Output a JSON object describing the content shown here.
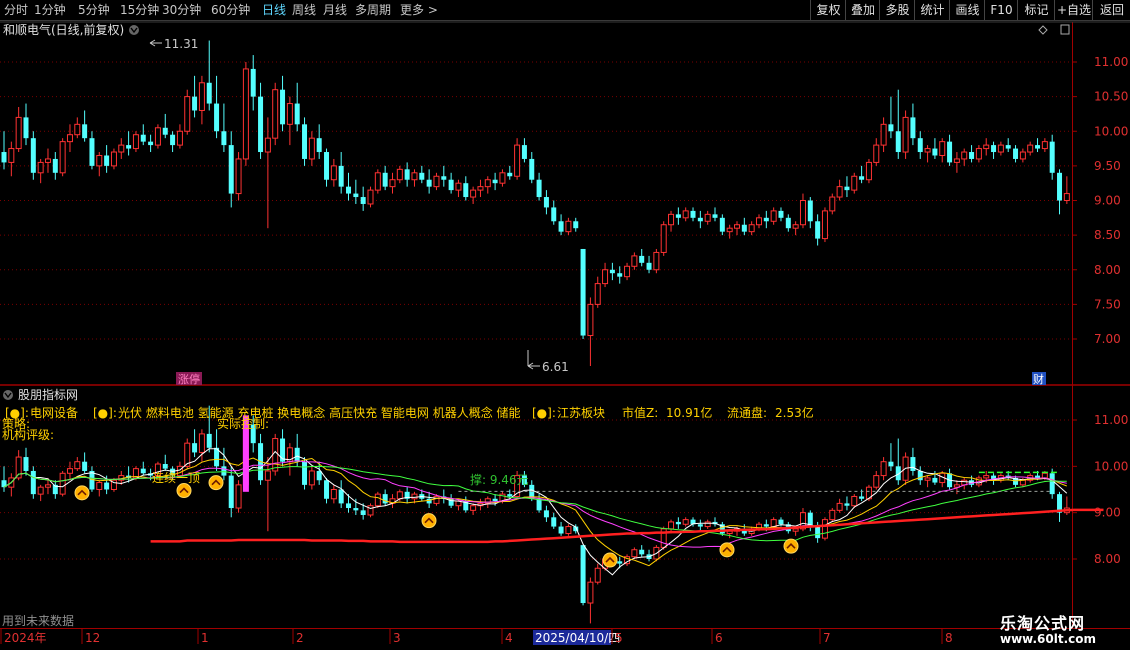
{
  "toolbar": {
    "timeframes": [
      "分时",
      "1分钟",
      "5分钟",
      "15分钟",
      "30分钟",
      "60分钟",
      "日线",
      "周线",
      "月线",
      "多周期",
      "更多 >"
    ],
    "active_index": 6,
    "buttons": [
      "复权",
      "叠加",
      "多股",
      "统计",
      "画线",
      "F10",
      "标记",
      "+自选",
      "返回"
    ]
  },
  "main_panel": {
    "title": "和顺电气(日线,前复权)",
    "high_label": "11.31",
    "low_label": "6.61",
    "limit_badge": "涨停",
    "finance_badge": "财"
  },
  "indicator_panel": {
    "title": "股朋指标网",
    "concept_marker": "[●]:",
    "concept1": "电网设备",
    "concepts2": "光伏 燃料电池 氢能源 充电桩 换电概念 高压快充 智能电网 机器人概念 储能",
    "region": "江苏板块",
    "market_cap_label": "市值Z:",
    "market_cap_value": "10.91亿",
    "float_cap_label": "流通盘:",
    "float_cap_value": "2.53亿",
    "strategy_label": "策略:",
    "rating_label": "机构评级:",
    "actual_control_label": "实际控制:",
    "support_label": "撑: 9.46元",
    "signal_label": "连续一顶",
    "footer_note": "用到未来数据"
  },
  "watermark": {
    "line1": "乐淘公式网",
    "line2": "www.60lt.com"
  },
  "chart_data": [
    {
      "type": "candlestick",
      "panel": "main",
      "ylim": [
        6.5,
        11.6
      ],
      "y_ticks": [
        7.0,
        7.5,
        8.0,
        8.5,
        9.0,
        9.5,
        10.0,
        10.5,
        11.0
      ],
      "ohlc": [
        [
          9.7,
          10.0,
          9.45,
          9.55
        ],
        [
          9.55,
          9.85,
          9.35,
          9.75
        ],
        [
          9.75,
          10.35,
          9.7,
          10.2
        ],
        [
          10.2,
          10.4,
          9.8,
          9.9
        ],
        [
          9.9,
          10.0,
          9.3,
          9.4
        ],
        [
          9.4,
          9.6,
          9.25,
          9.55
        ],
        [
          9.55,
          9.75,
          9.4,
          9.6
        ],
        [
          9.6,
          9.7,
          9.3,
          9.4
        ],
        [
          9.4,
          9.9,
          9.35,
          9.85
        ],
        [
          9.85,
          10.1,
          9.7,
          9.95
        ],
        [
          9.95,
          10.2,
          9.9,
          10.1
        ],
        [
          10.1,
          10.3,
          9.85,
          9.9
        ],
        [
          9.9,
          10.0,
          9.45,
          9.5
        ],
        [
          9.5,
          9.7,
          9.35,
          9.65
        ],
        [
          9.65,
          9.8,
          9.4,
          9.5
        ],
        [
          9.5,
          9.75,
          9.45,
          9.7
        ],
        [
          9.7,
          9.9,
          9.6,
          9.8
        ],
        [
          9.8,
          10.0,
          9.65,
          9.75
        ],
        [
          9.75,
          10.0,
          9.7,
          9.95
        ],
        [
          9.95,
          10.1,
          9.8,
          9.85
        ],
        [
          9.85,
          9.95,
          9.7,
          9.8
        ],
        [
          9.8,
          10.1,
          9.75,
          10.05
        ],
        [
          10.05,
          10.25,
          9.9,
          9.95
        ],
        [
          9.95,
          10.0,
          9.7,
          9.8
        ],
        [
          9.8,
          10.1,
          9.75,
          10.0
        ],
        [
          10.0,
          10.6,
          9.95,
          10.5
        ],
        [
          10.5,
          10.8,
          10.2,
          10.3
        ],
        [
          10.3,
          10.8,
          10.1,
          10.7
        ],
        [
          10.7,
          11.31,
          10.3,
          10.4
        ],
        [
          10.4,
          10.8,
          9.9,
          10.0
        ],
        [
          10.0,
          10.4,
          9.7,
          9.8
        ],
        [
          9.8,
          10.0,
          8.9,
          9.1
        ],
        [
          9.1,
          9.7,
          9.0,
          9.6
        ],
        [
          9.6,
          11.0,
          9.5,
          10.9
        ],
        [
          10.9,
          11.1,
          10.3,
          10.5
        ],
        [
          10.5,
          10.7,
          9.6,
          9.7
        ],
        [
          9.7,
          10.2,
          8.6,
          9.9
        ],
        [
          9.9,
          10.7,
          9.8,
          10.6
        ],
        [
          10.6,
          10.8,
          10.0,
          10.1
        ],
        [
          10.1,
          10.5,
          9.8,
          10.4
        ],
        [
          10.4,
          10.7,
          10.0,
          10.1
        ],
        [
          10.1,
          10.2,
          9.5,
          9.6
        ],
        [
          9.6,
          10.0,
          9.5,
          9.9
        ],
        [
          9.9,
          10.1,
          9.6,
          9.7
        ],
        [
          9.7,
          9.75,
          9.2,
          9.3
        ],
        [
          9.3,
          9.6,
          9.2,
          9.5
        ],
        [
          9.5,
          9.7,
          9.1,
          9.2
        ],
        [
          9.2,
          9.4,
          9.0,
          9.1
        ],
        [
          9.1,
          9.3,
          8.95,
          9.05
        ],
        [
          9.05,
          9.2,
          8.85,
          8.95
        ],
        [
          8.95,
          9.2,
          8.9,
          9.15
        ],
        [
          9.15,
          9.45,
          9.1,
          9.4
        ],
        [
          9.4,
          9.5,
          9.15,
          9.2
        ],
        [
          9.2,
          9.4,
          9.1,
          9.3
        ],
        [
          9.3,
          9.5,
          9.25,
          9.45
        ],
        [
          9.45,
          9.55,
          9.2,
          9.3
        ],
        [
          9.3,
          9.45,
          9.2,
          9.4
        ],
        [
          9.4,
          9.5,
          9.25,
          9.3
        ],
        [
          9.3,
          9.45,
          9.1,
          9.2
        ],
        [
          9.2,
          9.4,
          9.15,
          9.35
        ],
        [
          9.35,
          9.5,
          9.2,
          9.3
        ],
        [
          9.3,
          9.4,
          9.1,
          9.15
        ],
        [
          9.15,
          9.3,
          9.05,
          9.25
        ],
        [
          9.25,
          9.35,
          9.0,
          9.05
        ],
        [
          9.05,
          9.2,
          8.95,
          9.15
        ],
        [
          9.15,
          9.3,
          9.05,
          9.2
        ],
        [
          9.2,
          9.35,
          9.1,
          9.3
        ],
        [
          9.3,
          9.4,
          9.15,
          9.25
        ],
        [
          9.25,
          9.45,
          9.2,
          9.4
        ],
        [
          9.4,
          9.5,
          9.3,
          9.35
        ],
        [
          9.35,
          9.9,
          9.3,
          9.8
        ],
        [
          9.8,
          9.9,
          9.55,
          9.6
        ],
        [
          9.6,
          9.7,
          9.25,
          9.3
        ],
        [
          9.3,
          9.4,
          9.0,
          9.05
        ],
        [
          9.05,
          9.15,
          8.8,
          8.9
        ],
        [
          8.9,
          9.0,
          8.65,
          8.7
        ],
        [
          8.7,
          8.8,
          8.5,
          8.55
        ],
        [
          8.55,
          8.75,
          8.5,
          8.7
        ],
        [
          8.7,
          8.75,
          8.55,
          8.6
        ],
        [
          8.3,
          8.3,
          7.0,
          7.05
        ],
        [
          7.05,
          7.6,
          6.61,
          7.5
        ],
        [
          7.5,
          7.9,
          7.45,
          7.8
        ],
        [
          7.8,
          8.1,
          7.75,
          8.0
        ],
        [
          8.0,
          8.1,
          7.85,
          7.95
        ],
        [
          7.95,
          8.05,
          7.8,
          7.9
        ],
        [
          7.9,
          8.1,
          7.85,
          8.05
        ],
        [
          8.05,
          8.25,
          8.0,
          8.2
        ],
        [
          8.2,
          8.3,
          8.05,
          8.1
        ],
        [
          8.1,
          8.2,
          7.95,
          8.0
        ],
        [
          8.0,
          8.3,
          7.95,
          8.25
        ],
        [
          8.25,
          8.7,
          8.2,
          8.65
        ],
        [
          8.65,
          8.85,
          8.55,
          8.8
        ],
        [
          8.8,
          8.9,
          8.65,
          8.75
        ],
        [
          8.75,
          8.9,
          8.7,
          8.85
        ],
        [
          8.85,
          8.9,
          8.7,
          8.75
        ],
        [
          8.75,
          8.85,
          8.6,
          8.7
        ],
        [
          8.7,
          8.85,
          8.65,
          8.8
        ],
        [
          8.8,
          8.9,
          8.7,
          8.75
        ],
        [
          8.75,
          8.8,
          8.5,
          8.55
        ],
        [
          8.55,
          8.65,
          8.45,
          8.6
        ],
        [
          8.6,
          8.7,
          8.5,
          8.65
        ],
        [
          8.65,
          8.75,
          8.5,
          8.55
        ],
        [
          8.55,
          8.7,
          8.5,
          8.65
        ],
        [
          8.65,
          8.8,
          8.6,
          8.75
        ],
        [
          8.75,
          8.85,
          8.6,
          8.7
        ],
        [
          8.7,
          8.9,
          8.65,
          8.85
        ],
        [
          8.85,
          8.9,
          8.7,
          8.75
        ],
        [
          8.75,
          8.8,
          8.55,
          8.6
        ],
        [
          8.6,
          8.7,
          8.5,
          8.65
        ],
        [
          8.65,
          9.1,
          8.6,
          9.0
        ],
        [
          9.0,
          9.05,
          8.6,
          8.7
        ],
        [
          8.7,
          8.8,
          8.35,
          8.45
        ],
        [
          8.45,
          8.9,
          8.4,
          8.85
        ],
        [
          8.85,
          9.1,
          8.8,
          9.05
        ],
        [
          9.05,
          9.3,
          9.0,
          9.2
        ],
        [
          9.2,
          9.35,
          9.05,
          9.15
        ],
        [
          9.15,
          9.4,
          9.1,
          9.35
        ],
        [
          9.35,
          9.5,
          9.25,
          9.3
        ],
        [
          9.3,
          9.6,
          9.25,
          9.55
        ],
        [
          9.55,
          9.9,
          9.5,
          9.8
        ],
        [
          9.8,
          10.2,
          9.7,
          10.1
        ],
        [
          10.1,
          10.5,
          9.9,
          10.0
        ],
        [
          10.0,
          10.6,
          9.6,
          9.7
        ],
        [
          9.7,
          10.3,
          9.6,
          10.2
        ],
        [
          10.2,
          10.4,
          9.8,
          9.9
        ],
        [
          9.9,
          10.0,
          9.6,
          9.7
        ],
        [
          9.7,
          9.8,
          9.55,
          9.75
        ],
        [
          9.75,
          9.9,
          9.6,
          9.65
        ],
        [
          9.65,
          9.9,
          9.55,
          9.85
        ],
        [
          9.85,
          9.95,
          9.5,
          9.55
        ],
        [
          9.55,
          9.7,
          9.4,
          9.6
        ],
        [
          9.6,
          9.75,
          9.5,
          9.7
        ],
        [
          9.7,
          9.8,
          9.55,
          9.6
        ],
        [
          9.6,
          9.8,
          9.55,
          9.75
        ],
        [
          9.75,
          9.9,
          9.65,
          9.8
        ],
        [
          9.8,
          9.85,
          9.6,
          9.7
        ],
        [
          9.7,
          9.85,
          9.65,
          9.8
        ],
        [
          9.8,
          9.9,
          9.7,
          9.75
        ],
        [
          9.75,
          9.8,
          9.55,
          9.6
        ],
        [
          9.6,
          9.75,
          9.55,
          9.7
        ],
        [
          9.7,
          9.85,
          9.65,
          9.8
        ],
        [
          9.8,
          9.9,
          9.7,
          9.75
        ],
        [
          9.75,
          9.9,
          9.7,
          9.85
        ],
        [
          9.85,
          9.95,
          9.3,
          9.4
        ],
        [
          9.4,
          9.45,
          8.8,
          9.0
        ],
        [
          9.0,
          9.35,
          8.95,
          9.1
        ]
      ]
    },
    {
      "type": "line",
      "panel": "indicator",
      "ylim": [
        7.6,
        11.7
      ],
      "y_ticks": [
        8.0,
        9.0,
        10.0,
        11.0
      ],
      "series": [
        {
          "color": "#ff2020",
          "values": [
            8.38,
            8.38,
            8.38,
            8.38,
            8.38,
            8.38,
            8.38,
            8.38,
            8.38,
            8.38,
            8.38,
            8.38,
            8.38,
            8.38,
            8.38,
            8.38,
            8.38,
            8.38,
            8.38,
            8.38,
            8.38,
            8.38,
            8.38,
            8.38,
            8.38,
            8.4,
            8.4,
            8.4,
            8.4,
            8.4,
            8.4,
            8.4,
            8.41,
            8.41,
            8.41,
            8.41,
            8.41,
            8.41,
            8.41,
            8.41,
            8.41,
            8.41,
            8.4,
            8.4,
            8.4,
            8.4,
            8.4,
            8.39,
            8.39,
            8.39,
            8.38,
            8.38,
            8.38,
            8.38,
            8.37,
            8.37,
            8.37,
            8.37,
            8.37,
            8.37,
            8.37,
            8.37,
            8.37,
            8.37,
            8.37,
            8.37,
            8.37,
            8.38,
            8.38,
            8.39,
            8.4,
            8.41,
            8.42,
            8.43,
            8.44,
            8.45,
            8.46,
            8.47,
            8.48,
            8.49,
            8.5,
            8.51,
            8.52,
            8.53,
            8.54,
            8.55,
            8.55,
            8.56,
            8.56,
            8.57,
            8.57,
            8.58,
            8.58,
            8.59,
            8.59,
            8.6,
            8.6,
            8.61,
            8.61,
            8.62,
            8.62,
            8.63,
            8.63,
            8.64,
            8.64,
            8.65,
            8.66,
            8.67,
            8.68,
            8.69,
            8.7,
            8.71,
            8.72,
            8.73,
            8.74,
            8.75,
            8.76,
            8.77,
            8.78,
            8.79,
            8.8,
            8.81,
            8.82,
            8.83,
            8.84,
            8.85,
            8.86,
            8.87,
            8.88,
            8.89,
            8.9,
            8.91,
            8.92,
            8.93,
            8.94,
            8.95,
            8.96,
            8.97,
            8.98,
            8.99,
            9.0,
            9.01,
            9.02,
            9.03,
            9.04,
            9.05,
            9.06,
            9.06,
            9.06,
            9.06,
            9.06
          ]
        }
      ]
    }
  ],
  "x_axis": {
    "labels": [
      "2024年",
      "12",
      "1",
      "2",
      "3",
      "4",
      "2025/04/10/四",
      "5",
      "6",
      "7",
      "8"
    ]
  }
}
